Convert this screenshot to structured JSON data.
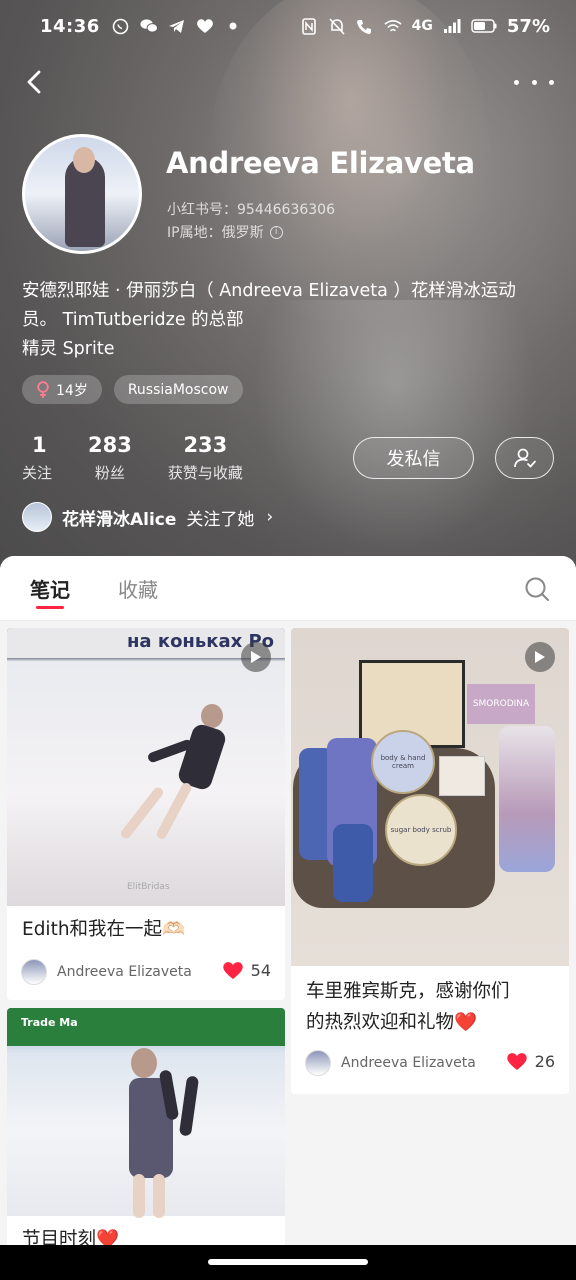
{
  "status_bar": {
    "time": "14:36",
    "network": "4G",
    "battery": "57%"
  },
  "profile": {
    "name": "Andreeva Elizaveta",
    "red_id_label": "小红书号：",
    "red_id": "95446636306",
    "ip_label": "IP属地：",
    "ip_location": "俄罗斯",
    "bio_line1": "安德烈耶娃 · 伊丽莎白（ Andreeva Elizaveta ）花样滑冰运动",
    "bio_line2": "员。 TimTutberidze 的总部",
    "bio_line3": "精灵 Sprite",
    "tags": {
      "age": "14岁",
      "location": "RussiaMoscow"
    },
    "stats": {
      "following_num": "1",
      "following_label": "关注",
      "fans_num": "283",
      "fans_label": "粉丝",
      "likes_num": "233",
      "likes_label": "获赞与收藏"
    },
    "message_button": "发私信",
    "followed_by_user": "花样滑冰Alice",
    "followed_by_suffix": "关注了她"
  },
  "tabs": {
    "notes": "笔记",
    "favorites": "收藏"
  },
  "cards": [
    {
      "banner_text": "на коньках Ро",
      "title": "Edith和我在一起🫶🏻",
      "author": "Andreeva Elizaveta",
      "likes": "54",
      "watermark": "ElitBridas"
    },
    {
      "title_line1": "车里雅宾斯克，感谢你们",
      "title_line2": "的热烈欢迎和礼物❤️",
      "author": "Andreeva Elizaveta",
      "likes": "26",
      "label_smorodina": "SMORODINA",
      "jar1_label": "body & hand cream",
      "jar2_label": "sugar body scrub"
    },
    {
      "title": "节目时刻❤️",
      "banner_text": "Trade Ma"
    }
  ],
  "colors": {
    "accent": "#ff2442",
    "header_bg": "#5e5c5c"
  }
}
